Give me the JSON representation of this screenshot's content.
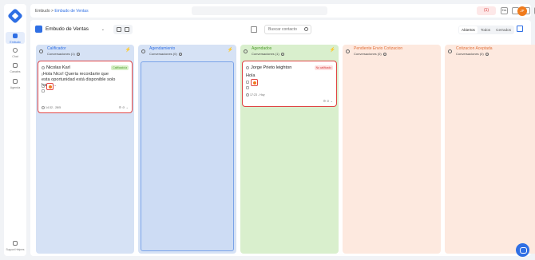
{
  "sidebar": {
    "items": [
      {
        "label": "Embudo"
      },
      {
        "label": "Chat"
      },
      {
        "label": "Canales"
      },
      {
        "label": "Agenda"
      }
    ],
    "bottom_label": "Support Helpers"
  },
  "topbar": {
    "crumb_home": "Embudo",
    "crumb_sep": ">",
    "crumb_current": "Embudo de Ventas",
    "notif_count": "(1)",
    "lang": "Esk",
    "avatar_initial": "JP"
  },
  "toolbar": {
    "pipeline_name": "Embudo de Ventas",
    "search_placeholder": "Buscar contacto",
    "tabs": [
      "Abiertos",
      "Todos",
      "Cerrados"
    ]
  },
  "columns": [
    {
      "title": "Calificador",
      "sub": "Conversaciones (1)"
    },
    {
      "title": "Agendamiento",
      "sub": "Conversaciones (0)"
    },
    {
      "title": "Agendados",
      "sub": "Conversaciones (1)"
    },
    {
      "title": "Pendiente Envio Cotizacion",
      "sub": "Conversaciones (0)"
    },
    {
      "title": "Cotizacion Aceptada",
      "sub": "Conversaciones (0)"
    }
  ],
  "cards": [
    {
      "name": "Nicolas Karl",
      "badge": "Calificado/a",
      "message": "¡Hola Nico! Queria recordarte que esta oportunidad está disponible solo hasta...",
      "time": "14:32 - 28/5"
    },
    {
      "name": "Jorge Prieto leighton",
      "badge": "No calificado",
      "message": "Hola",
      "time": "17:23 - Hoy"
    }
  ],
  "colors": {
    "accent": "#2f6fe4",
    "blue_column": "#d6e2f5",
    "green_column": "#d9efcd",
    "orange_column": "#fde9df",
    "highlight": "#e04545"
  }
}
